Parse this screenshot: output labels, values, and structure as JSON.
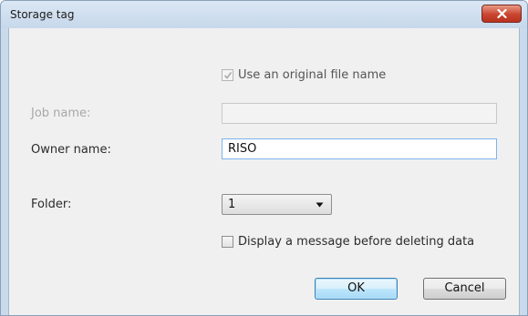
{
  "window": {
    "title": "Storage tag"
  },
  "icons": {
    "close": "close-icon",
    "check": "checkmark-icon",
    "dropdown": "chevron-down-icon"
  },
  "form": {
    "use_original_file_name": {
      "label": "Use an original file name",
      "checked": true,
      "enabled": false
    },
    "job_name": {
      "label": "Job name:",
      "value": "",
      "enabled": false
    },
    "owner_name": {
      "label": "Owner name:",
      "value": "RISO"
    },
    "folder": {
      "label": "Folder:",
      "selected": "1"
    },
    "display_message_before_deleting": {
      "label": "Display a message before deleting data",
      "checked": false
    }
  },
  "buttons": {
    "ok": "OK",
    "cancel": "Cancel"
  },
  "colors": {
    "title_bar": "#c6d8eb",
    "close_button": "#c8452f",
    "dialog_background": "#f0f0f0",
    "default_button": "#bee6fd"
  }
}
